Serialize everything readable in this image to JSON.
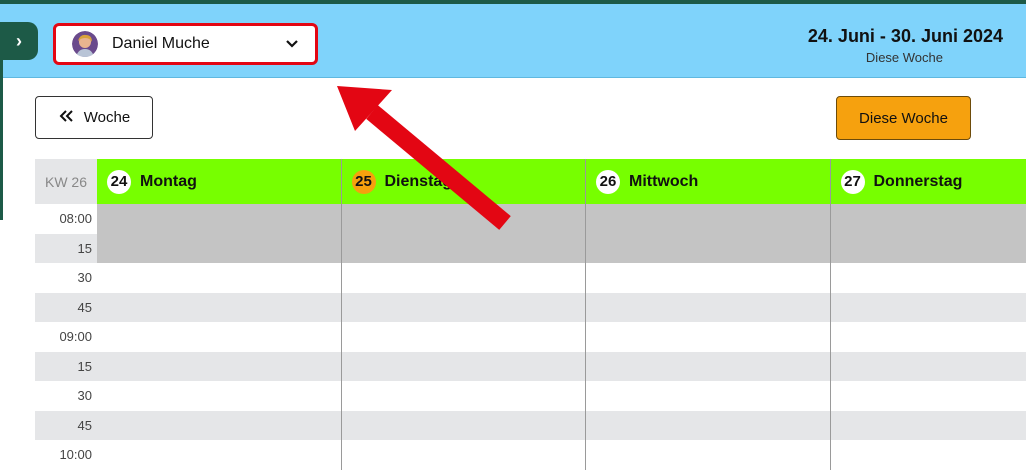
{
  "header": {
    "user_name": "Daniel Muche",
    "date_range": "24. Juni - 30. Juni 2024",
    "date_subtitle": "Diese Woche",
    "sidebar_toggle": "›"
  },
  "toolbar": {
    "prev_week_label": "Woche",
    "this_week_label": "Diese Woche"
  },
  "calendar": {
    "week_label": "KW 26",
    "days": [
      {
        "num": "24",
        "name": "Montag",
        "today": false
      },
      {
        "num": "25",
        "name": "Dienstag",
        "today": true
      },
      {
        "num": "26",
        "name": "Mittwoch",
        "today": false
      },
      {
        "num": "27",
        "name": "Donnerstag",
        "today": false
      }
    ],
    "times": [
      "08:00",
      "15",
      "30",
      "45",
      "09:00",
      "15",
      "30",
      "45",
      "10:00"
    ],
    "blocked_rows": 2
  },
  "colors": {
    "header_bg": "#7fd3fb",
    "day_header_bg": "#77ff00",
    "today_badge": "#f6a10e",
    "primary_button": "#f6a10e",
    "highlight_border": "#e30613",
    "blocked_slot": "#c4c4c4",
    "alt_row": "#e5e6e8"
  }
}
